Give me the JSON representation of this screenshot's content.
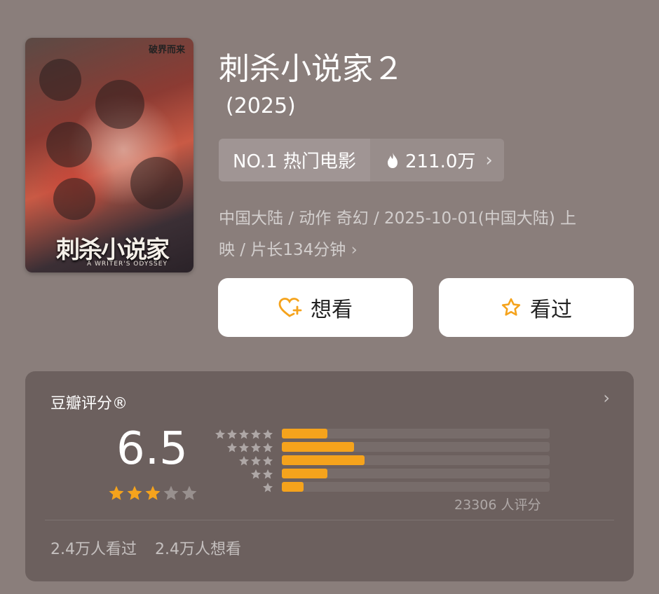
{
  "movie": {
    "title": "刺杀小说家２",
    "year": "(2025)",
    "rank_label": "NO.1 热门电影",
    "heat": "211.0万",
    "meta_line1": "中国大陆 / 动作 奇幻 / 2025-10-01(中国大陆) 上",
    "meta_line2": "映 / 片长134分钟",
    "poster": {
      "title_text": "刺杀小说家",
      "subtitle_text": "A WRITER'S ODYSSEY",
      "tagline": "破界而来"
    }
  },
  "actions": {
    "want_label": "想看",
    "seen_label": "看过"
  },
  "rating": {
    "label": "豆瓣评分®",
    "score": "6.5",
    "stars_filled": 3,
    "stars_total": 5,
    "distribution": [
      {
        "stars": 5,
        "fraction": 0.17
      },
      {
        "stars": 4,
        "fraction": 0.27
      },
      {
        "stars": 3,
        "fraction": 0.31
      },
      {
        "stars": 2,
        "fraction": 0.17
      },
      {
        "stars": 1,
        "fraction": 0.08
      }
    ],
    "count_text": "23306 人评分",
    "seen_text": "2.4万人看过",
    "want_text": "2.4万人想看"
  },
  "colors": {
    "accent": "#f5a31c",
    "background": "#8a7e7b"
  },
  "icons": {
    "flame": "flame-icon",
    "heart_plus": "heart-plus-icon",
    "star": "star-icon",
    "chevron": "chevron-right-icon"
  }
}
